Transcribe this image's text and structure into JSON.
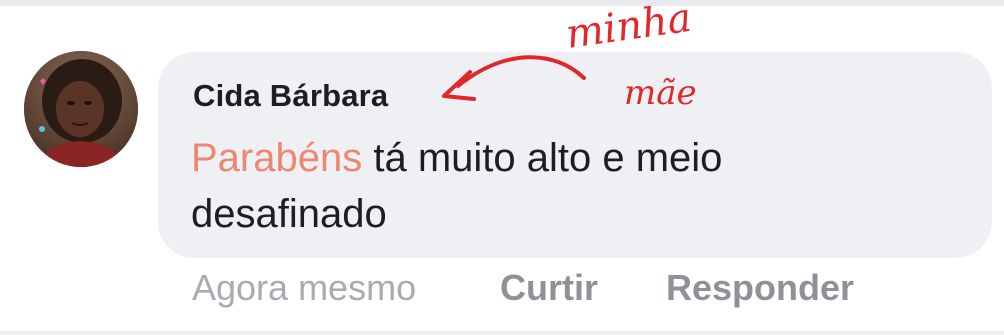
{
  "comment": {
    "author": "Cida Bárbara",
    "highlight_word": "Parabéns",
    "text_line1_rest": " tá muito alto e meio",
    "text_line2": "desafinado",
    "highlight_color": "#ec8872"
  },
  "actions": {
    "time": "Agora mesmo",
    "like_label": "Curtir",
    "reply_label": "Responder"
  },
  "annotation": {
    "word1": "minha",
    "word2": "mãe",
    "color": "#e0282a"
  }
}
